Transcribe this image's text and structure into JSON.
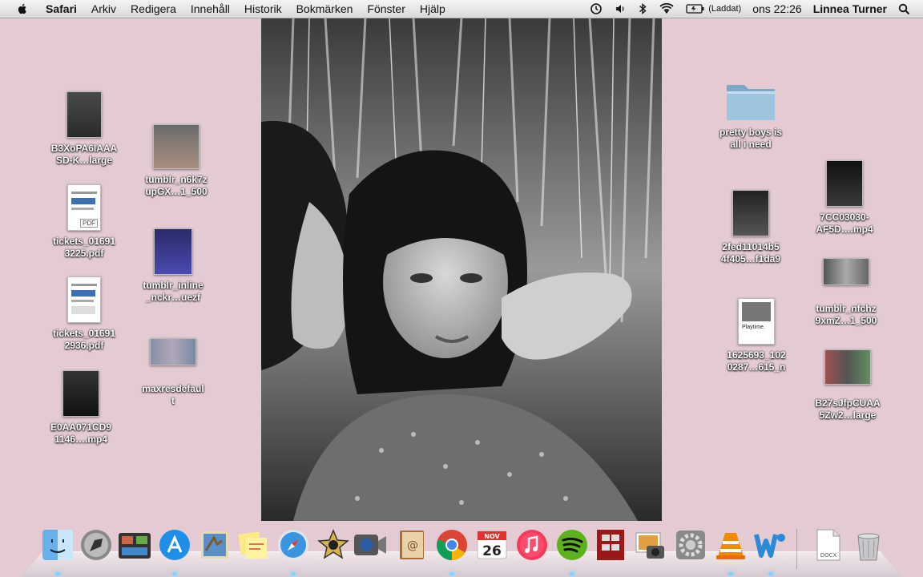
{
  "menubar": {
    "app": "Safari",
    "menus": [
      "Arkiv",
      "Redigera",
      "Innehåll",
      "Historik",
      "Bokmärken",
      "Fönster",
      "Hjälp"
    ],
    "battery_status": "(Laddat)",
    "clock": "ons 22:26",
    "user": "Linnea Turner"
  },
  "desktop": {
    "left_column": [
      {
        "label_1": "B3XoPA6IAAA",
        "label_2": "SD-K…large"
      },
      {
        "label_1": "tickets_01691",
        "label_2": "3225.pdf",
        "badge": "PDF"
      },
      {
        "label_1": "tickets_01691",
        "label_2": "2936.pdf"
      },
      {
        "label_1": "E0AA071CD9",
        "label_2": "1146….mp4"
      }
    ],
    "second_column": [
      {
        "label_1": "tumblr_n6k7z",
        "label_2": "upGX…1_500"
      },
      {
        "label_1": "tumblr_inline",
        "label_2": "_nckr…uezf"
      },
      {
        "label_1": "maxresdefaul",
        "label_2": "t"
      }
    ],
    "right_inner": [
      {
        "label_1": "pretty boys is",
        "label_2": "all i need"
      },
      {
        "label_1": "2fed11014b5",
        "label_2": "4f405…f1da9"
      },
      {
        "label_1": "1625693_102",
        "label_2": "0287…615_n",
        "thumb_text": "Playtime."
      }
    ],
    "right_outer": [
      {
        "label_1": "7CC03030-",
        "label_2": "AF5D….mp4"
      },
      {
        "label_1": "tumblr_nfchz",
        "label_2": "9xmZ…1_500"
      },
      {
        "label_1": "B27sJfpCUAA",
        "label_2": "5Zw2…large"
      }
    ]
  },
  "dock": {
    "calendar_month": "NOV",
    "calendar_day": "26",
    "docx_label": "DOCX",
    "items": [
      "finder-icon",
      "launchpad-icon",
      "mission-control-icon",
      "app-store-icon",
      "mail-icon",
      "stickies-icon",
      "safari-icon",
      "imovie-icon",
      "facetime-icon",
      "contacts-icon",
      "chrome-icon",
      "calendar-icon",
      "itunes-icon",
      "spotify-icon",
      "photo-booth-icon",
      "iphoto-icon",
      "system-preferences-icon",
      "vlc-icon",
      "word-icon",
      "docx-file-icon",
      "trash-icon"
    ]
  },
  "colors": {
    "desktop_background": "#e4cbd3",
    "menubar": "#e6e6e6",
    "dock_indicator": "#7fd4ff"
  }
}
